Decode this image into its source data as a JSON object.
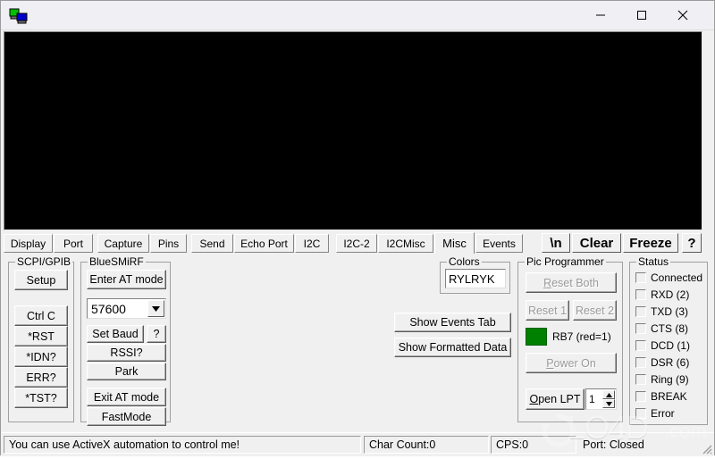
{
  "window": {
    "icon_name": "two-computers-network-icon",
    "title": "",
    "controls": {
      "minimize": "—",
      "maximize": "□",
      "close": "✕"
    }
  },
  "terminal": {
    "content": "",
    "background_color": "#000000"
  },
  "tabs": [
    {
      "label": "Display",
      "active": false
    },
    {
      "label": "Port",
      "active": false
    },
    {
      "label": "Capture",
      "active": false
    },
    {
      "label": "Pins",
      "active": false
    },
    {
      "label": "Send",
      "active": false
    },
    {
      "label": "Echo Port",
      "active": false
    },
    {
      "label": "I2C",
      "active": false
    },
    {
      "label": "I2C-2",
      "active": false
    },
    {
      "label": "I2CMisc",
      "active": false
    },
    {
      "label": "Misc",
      "active": true
    },
    {
      "label": "Events",
      "active": false
    }
  ],
  "toolbar_buttons": [
    {
      "label": "\\n"
    },
    {
      "label": "Clear"
    },
    {
      "label": "Freeze"
    },
    {
      "label": "?"
    }
  ],
  "scpi_gpib": {
    "title": "SCPI/GPIB",
    "setup_label": "Setup",
    "buttons": [
      {
        "label": "Ctrl C"
      },
      {
        "label": "*RST"
      },
      {
        "label": "*IDN?"
      },
      {
        "label": "ERR?"
      },
      {
        "label": "*TST?"
      }
    ]
  },
  "bluesmirf": {
    "title": "BlueSMiRF",
    "enter_at_mode": "Enter AT mode",
    "baud_value": "57600",
    "set_baud": "Set Baud",
    "help": "?",
    "rssi": "RSSI?",
    "park": "Park",
    "exit_at_mode": "Exit AT mode",
    "fastmode": "FastMode"
  },
  "colors": {
    "title": "Colors",
    "value": "RYLRYK"
  },
  "actions": {
    "show_events_tab": "Show Events Tab",
    "show_formatted_data": "Show Formatted Data"
  },
  "pic_programmer": {
    "title": "Pic Programmer",
    "reset_both": "Reset Both",
    "reset_1": "Reset 1",
    "reset_2": "Reset 2",
    "led_color": "#008000",
    "led_label": "RB7 (red=1)",
    "power_on": "Power On",
    "open_lpt": "Open LPT",
    "lpt_port": "1"
  },
  "status": {
    "title": "Status",
    "items": [
      {
        "label": "Connected",
        "checked": false
      },
      {
        "label": "RXD (2)",
        "checked": false
      },
      {
        "label": "TXD (3)",
        "checked": false
      },
      {
        "label": "CTS (8)",
        "checked": false
      },
      {
        "label": "DCD (1)",
        "checked": false
      },
      {
        "label": "DSR (6)",
        "checked": false
      },
      {
        "label": "Ring (9)",
        "checked": false
      },
      {
        "label": "BREAK",
        "checked": false
      },
      {
        "label": "Error",
        "checked": false
      }
    ]
  },
  "statusbar": {
    "message": "You can use ActiveX automation to control me!",
    "char_count": "Char Count:0",
    "cps": "CPS:0",
    "port": "Port: Closed"
  },
  "watermark": {
    "text": "LO4D",
    "suffix": ".com"
  }
}
